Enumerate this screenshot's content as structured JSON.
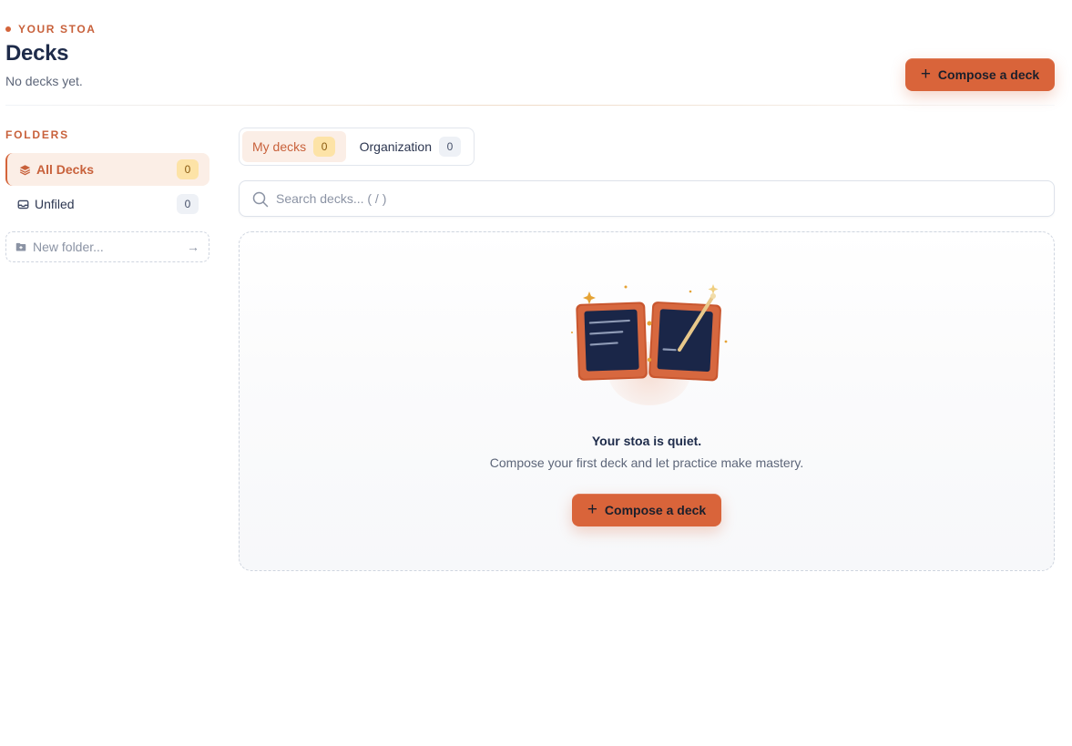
{
  "header": {
    "eyebrow": "YOUR STOA",
    "title": "Decks",
    "subtitle": "No decks yet.",
    "compose_label": "Compose a deck"
  },
  "sidebar": {
    "section_label": "FOLDERS",
    "items": [
      {
        "label": "All Decks",
        "count": "0",
        "icon": "layers-icon",
        "active": true
      },
      {
        "label": "Unfiled",
        "count": "0",
        "icon": "inbox-icon",
        "active": false
      }
    ],
    "new_folder_placeholder": "New folder..."
  },
  "tabs": [
    {
      "label": "My decks",
      "count": "0",
      "active": true
    },
    {
      "label": "Organization",
      "count": "0",
      "active": false
    }
  ],
  "search": {
    "placeholder": "Search decks... ( / )",
    "value": ""
  },
  "empty_state": {
    "title": "Your stoa is quiet.",
    "subtitle": "Compose your first deck and let practice make mastery.",
    "button_label": "Compose a deck"
  },
  "colors": {
    "accent": "#d9643a",
    "accent_text": "#c8613b",
    "active_bg": "#fbeee6",
    "badge_warm": "#fde3a7",
    "navy": "#1e2b4a"
  }
}
